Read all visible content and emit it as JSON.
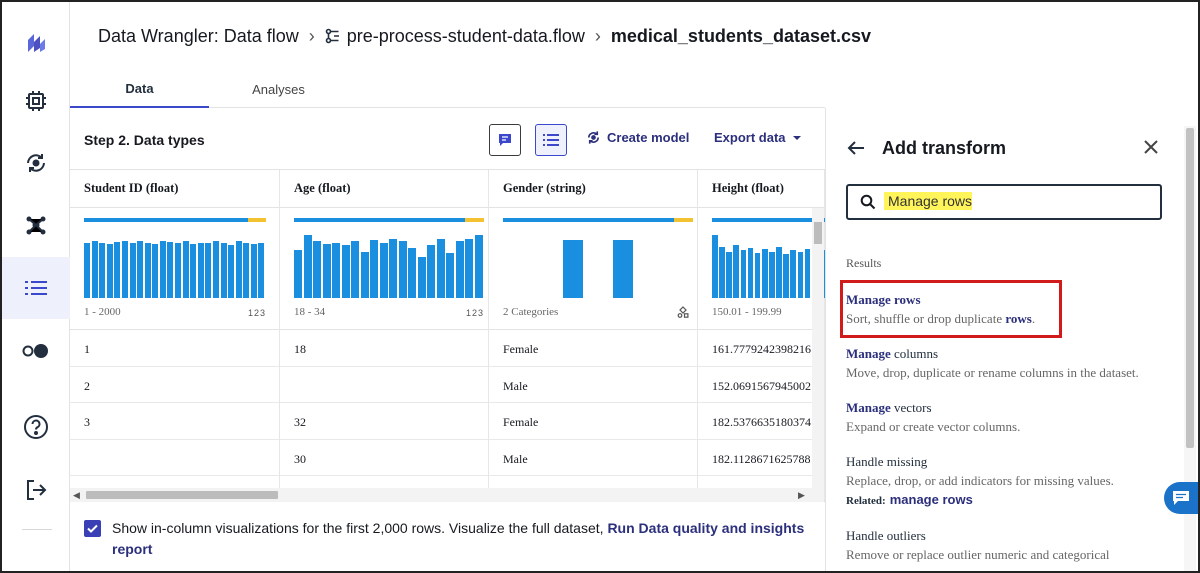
{
  "header": {
    "app": "Data Wrangler: Data flow",
    "flow": "pre-process-student-data.flow",
    "dataset": "medical_students_dataset.csv"
  },
  "tabs": [
    {
      "label": "Data",
      "active": true
    },
    {
      "label": "Analyses",
      "active": false
    }
  ],
  "toolbar": {
    "step_title": "Step 2. Data types",
    "create_model": "Create model",
    "export_data": "Export data"
  },
  "table": {
    "columns": [
      {
        "header": "Student ID (float)",
        "range": "1 - 2000",
        "type_icon": "123",
        "quality": [
          0.9,
          0.1
        ],
        "hist": [
          0.84,
          0.86,
          0.84,
          0.82,
          0.85,
          0.86,
          0.83,
          0.86,
          0.84,
          0.82,
          0.87,
          0.85,
          0.84,
          0.86,
          0.82,
          0.84,
          0.83,
          0.87,
          0.84,
          0.81,
          0.86,
          0.84,
          0.82,
          0.83
        ]
      },
      {
        "header": "Age (float)",
        "range": "18 - 34",
        "type_icon": "123",
        "quality": [
          0.9,
          0.1
        ],
        "hist": [
          0.72,
          0.95,
          0.86,
          0.82,
          0.84,
          0.8,
          0.86,
          0.7,
          0.88,
          0.84,
          0.9,
          0.86,
          0.76,
          0.62,
          0.8,
          0.9,
          0.68,
          0.86,
          0.9,
          0.96
        ]
      },
      {
        "header": "Gender (string)",
        "range": "2 Categories",
        "type_icon": "category-icon",
        "quality": [
          0.9,
          0.1
        ],
        "hist": [
          1.0,
          1.0
        ]
      },
      {
        "header": "Height (float)",
        "range": "150.01 - 199.99",
        "type_icon": "",
        "quality": [
          1.0,
          0.0
        ],
        "hist": [
          0.95,
          0.78,
          0.7,
          0.8,
          0.72,
          0.76,
          0.68,
          0.74,
          0.7,
          0.78,
          0.66,
          0.72,
          0.7,
          0.75,
          0.7,
          0.72
        ]
      }
    ],
    "rows": [
      [
        "1",
        "18",
        "Female",
        "161.7779242398216"
      ],
      [
        "2",
        "",
        "Male",
        "152.0691567945002"
      ],
      [
        "3",
        "32",
        "Female",
        "182.5376635180374"
      ],
      [
        "",
        "30",
        "Male",
        "182.1128671625788"
      ],
      [
        "",
        "",
        "",
        ""
      ]
    ]
  },
  "footer": {
    "text": "Show in-column visualizations for the first 2,000 rows. Visualize the full dataset,",
    "link": "Run Data quality and insights report",
    "checked": true
  },
  "panel": {
    "title": "Add transform",
    "search_value": "Manage rows",
    "results_label": "Results",
    "results": [
      {
        "title_bold": "Manage rows",
        "title_rest": "",
        "desc": "Sort, shuffle or drop duplicate",
        "desc_bold": "rows",
        "desc_end": ".",
        "related": ""
      },
      {
        "title_bold": "Manage",
        "title_rest": " columns",
        "desc": "Move, drop, duplicate or rename columns in the dataset.",
        "desc_bold": "",
        "desc_end": "",
        "related": ""
      },
      {
        "title_bold": "Manage",
        "title_rest": " vectors",
        "desc": "Expand or create vector columns.",
        "desc_bold": "",
        "desc_end": "",
        "related": ""
      },
      {
        "title_bold": "",
        "title_rest": "Handle missing",
        "desc": "Replace, drop, or add indicators for missing values.",
        "desc_bold": "",
        "desc_end": "",
        "related_label": "Related:",
        "related": "manage rows"
      },
      {
        "title_bold": "",
        "title_rest": "Handle outliers",
        "desc": "Remove or replace outlier numeric and categorical",
        "desc_bold": "",
        "desc_end": "",
        "related": ""
      }
    ]
  },
  "colors": {
    "accent": "#3b48cc",
    "bar": "#1a8fdf",
    "quality_ok": "#1a8fdf",
    "quality_warn": "#f2c230",
    "highlight": "#d11a1a"
  }
}
